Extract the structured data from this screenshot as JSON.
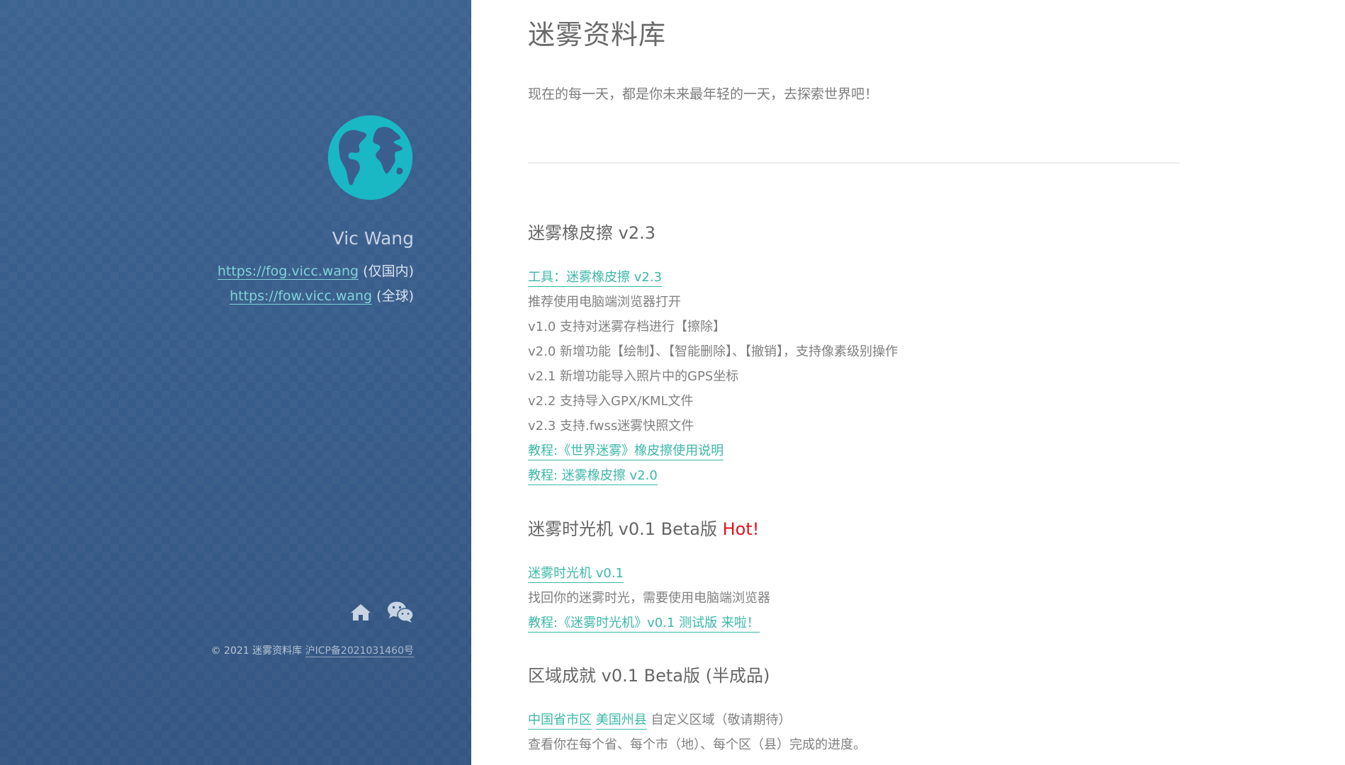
{
  "sidebar": {
    "author": "Vic Wang",
    "sites": [
      {
        "url": "https://fog.vicc.wang",
        "note": "(仅国内)"
      },
      {
        "url": "https://fow.vicc.wang",
        "note": "(全球)"
      }
    ],
    "icons": [
      "home-icon",
      "wechat-icon"
    ],
    "footer": {
      "copyright": "© 2021 迷雾资料库",
      "icp": "沪ICP备2021031460号"
    }
  },
  "main": {
    "title": "迷雾资料库",
    "tagline": "现在的每一天，都是你未来最年轻的一天，去探索世界吧！",
    "sections": [
      {
        "title": "迷雾橡皮擦 v2.3",
        "links": [
          "工具：迷雾橡皮擦 v2.3",
          "教程:《世界迷雾》橡皮擦使用说明",
          "教程: 迷雾橡皮擦 v2.0"
        ],
        "notes": [
          "推荐使用电脑端浏览器打开",
          "v1.0 支持对迷雾存档进行【擦除】",
          "v2.0 新增功能【绘制】、【智能删除】、【撤销】，支持像素级别操作",
          "v2.1 新增功能导入照片中的GPS坐标",
          "v2.2 支持导入GPX/KML文件",
          "v2.3 支持.fwss迷雾快照文件"
        ]
      },
      {
        "title": "迷雾时光机 v0.1 Beta版",
        "badge": "Hot!",
        "links": [
          "迷雾时光机 v0.1",
          "教程:《迷雾时光机》v0.1 测试版 来啦！"
        ],
        "notes": [
          "找回你的迷雾时光，需要使用电脑端浏览器"
        ]
      },
      {
        "title": "区域成就 v0.1 Beta版 (半成品)",
        "links": [
          "中国省市区",
          "美国州县"
        ],
        "notes": [
          "自定义区域（敬请期待）",
          "查看你在每个省、每个市（地）、每个区（县）完成的进度。"
        ]
      }
    ]
  },
  "colors": {
    "sidebar": "#3a5f8f",
    "globe": "#19b8c4",
    "link": "#3cb8a8",
    "hot": "#e0141e"
  }
}
